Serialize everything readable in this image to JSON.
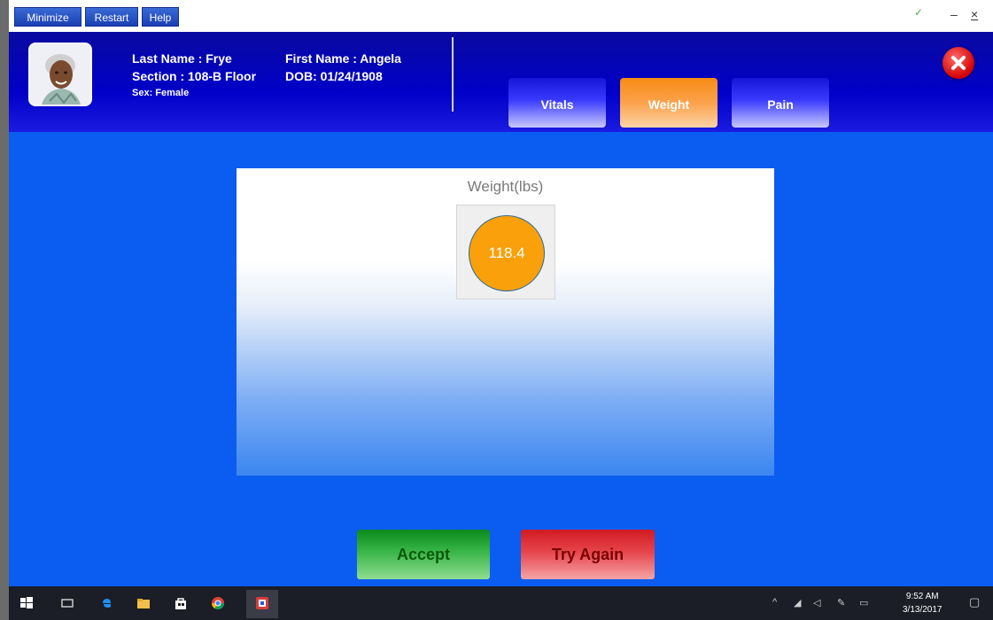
{
  "menu": {
    "minimize": "Minimize",
    "restart": "Restart",
    "help": "Help"
  },
  "window_controls": {
    "check": "✓",
    "minimize": "–",
    "close": "×"
  },
  "patient": {
    "last_name": "Last Name : Frye",
    "first_name": "First Name : Angela",
    "section": "Section : 108-B Floor",
    "dob": "DOB: 01/24/1908",
    "sex": "Sex: Female"
  },
  "tabs": [
    {
      "label": "Vitals",
      "active": false
    },
    {
      "label": "Weight",
      "active": true
    },
    {
      "label": "Pain",
      "active": false
    }
  ],
  "weight_panel": {
    "title": "Weight(lbs)",
    "value": "118.4"
  },
  "actions": {
    "accept": "Accept",
    "try_again": "Try Again"
  },
  "taskbar": {
    "time": "9:52 AM",
    "date": "3/13/2017"
  },
  "colors": {
    "accent_orange": "#f88a14",
    "accept_green": "#34b244",
    "retry_red": "#e6454b",
    "background_blue": "#0b5cf0"
  }
}
